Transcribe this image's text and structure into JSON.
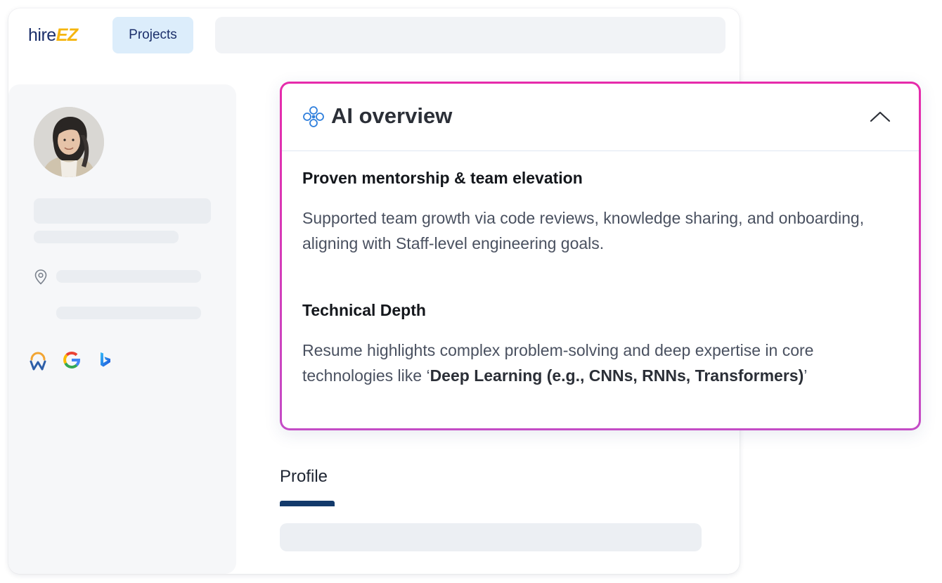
{
  "brand": {
    "logo_hire": "hire",
    "logo_ez": "EZ"
  },
  "nav": {
    "projects_label": "Projects"
  },
  "ai_overview": {
    "title": "AI overview",
    "sections": [
      {
        "title": "Proven mentorship & team elevation",
        "body": "Supported team growth via code reviews, knowledge sharing, and onboarding, aligning with Staff-level engineering goals."
      },
      {
        "title": "Technical Depth",
        "body_prefix": "Resume highlights complex problem-solving and deep expertise in core technologies like ‘",
        "body_bold": "Deep Learning (e.g., CNNs, RNNs, Transformers)",
        "body_suffix": "’"
      }
    ]
  },
  "profile": {
    "tab_label": "Profile"
  },
  "sources": [
    "workday-icon",
    "google-icon",
    "bing-icon"
  ],
  "colors": {
    "brand_navy": "#1b2f6b",
    "brand_yellow": "#f5b50e",
    "card_border_top": "#e62bab",
    "card_border_bottom": "#c44cc6",
    "tab_active": "#133a6b"
  }
}
